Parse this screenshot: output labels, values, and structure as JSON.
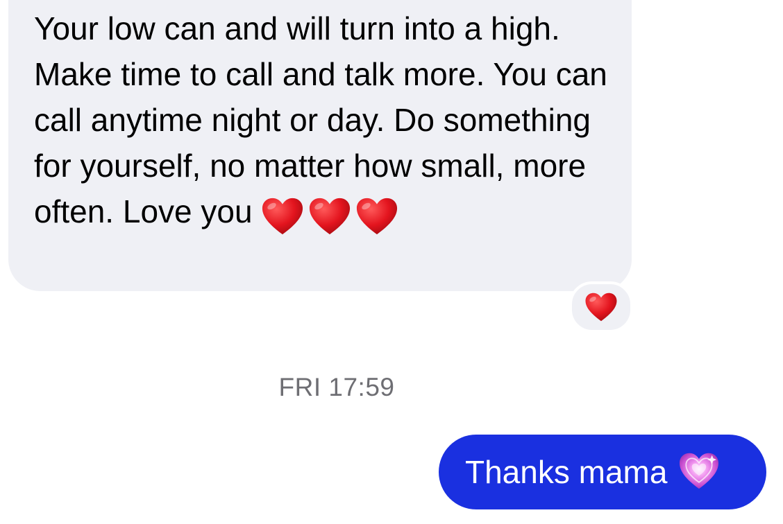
{
  "conversation": {
    "received_message": {
      "text": "Your low can and will turn into a high. Make time to call and talk more. You can call anytime night or day. Do something for yourself, no matter how small, more often. Love you",
      "trailing_emoji": [
        "red-heart-emoji",
        "red-heart-emoji",
        "red-heart-emoji"
      ],
      "reaction": "red-heart-emoji",
      "bubble_color": "#eff0f5"
    },
    "timestamp": "FRI 17:59",
    "sent_message": {
      "text": "Thanks mama",
      "trailing_emoji": "sparkling-heart-emoji",
      "bubble_color": "#1a30e0"
    }
  },
  "colors": {
    "heart_red": "#e0141e",
    "sparkle_pink": "#d65bd8",
    "timestamp_gray": "#6e6e73"
  }
}
